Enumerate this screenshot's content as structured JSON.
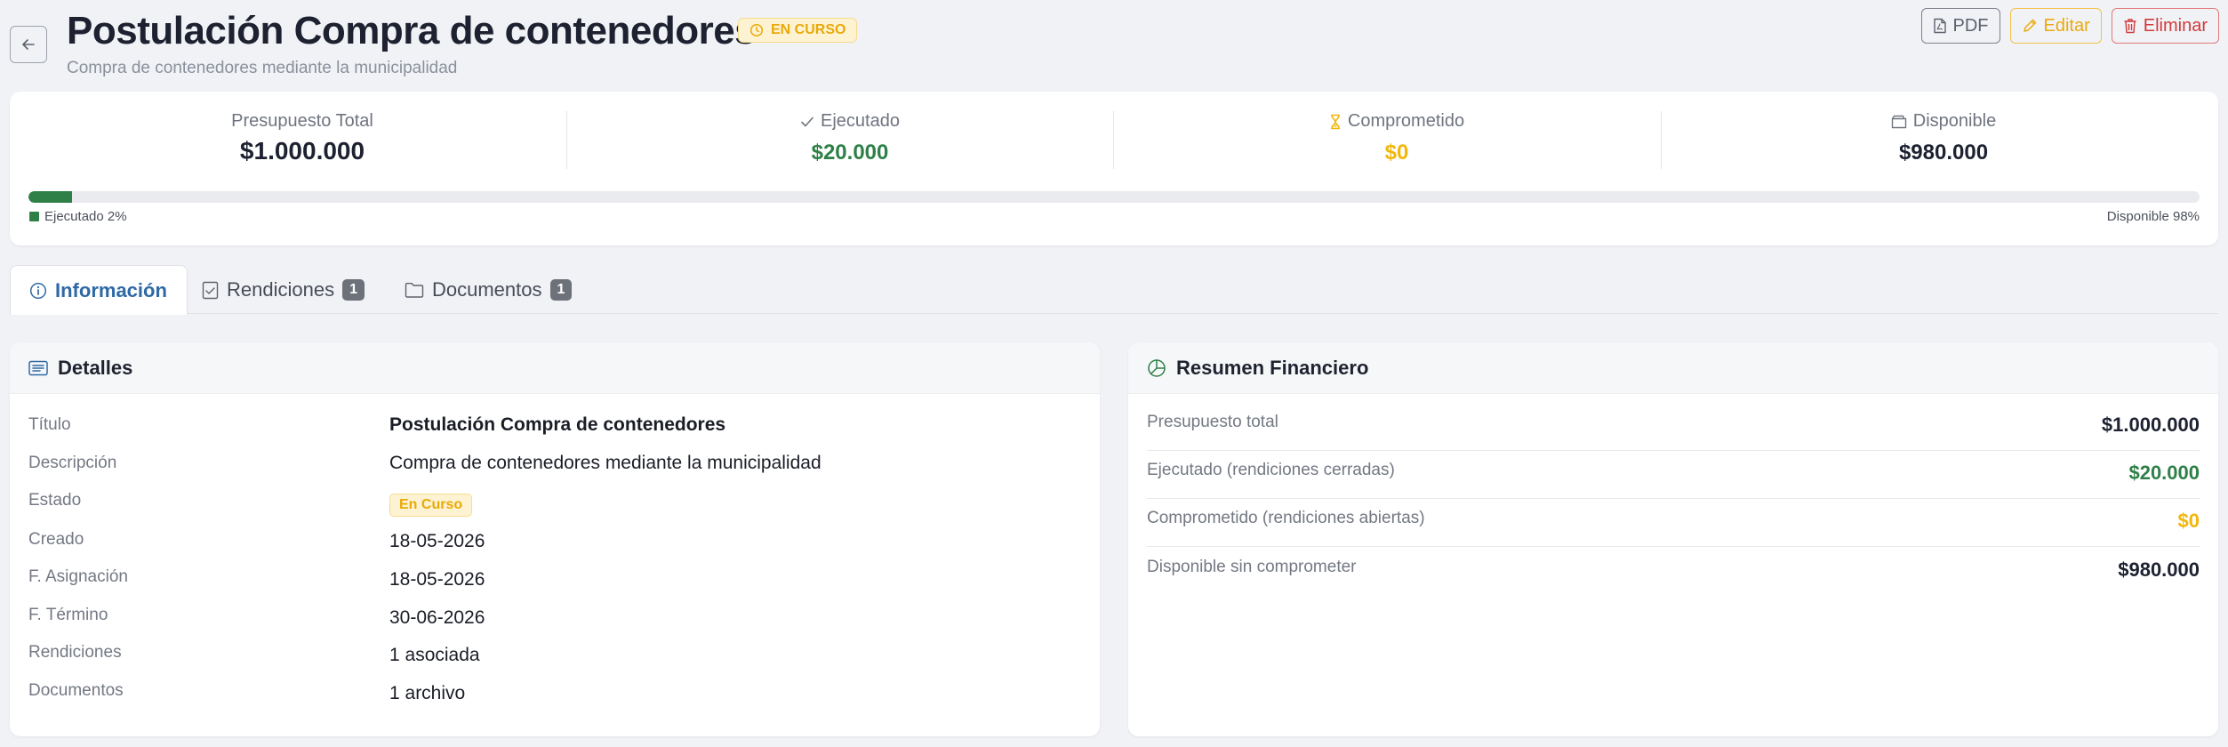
{
  "header": {
    "title": "Postulación Compra de contenedores",
    "status": "EN CURSO",
    "subtitle": "Compra de contenedores mediante la municipalidad",
    "actions": {
      "pdf": "PDF",
      "edit": "Editar",
      "delete": "Eliminar"
    }
  },
  "budget": {
    "total_label": "Presupuesto Total",
    "total_value": "$1.000.000",
    "executed_label": "Ejecutado",
    "executed_value": "$20.000",
    "committed_label": "Comprometido",
    "committed_value": "$0",
    "available_label": "Disponible",
    "available_value": "$980.000",
    "executed_percent": 2,
    "legend_executed": "Ejecutado 2%",
    "legend_available": "Disponible 98%"
  },
  "tabs": [
    {
      "label": "Información",
      "badge": ""
    },
    {
      "label": "Rendiciones",
      "badge": "1"
    },
    {
      "label": "Documentos",
      "badge": "1"
    }
  ],
  "details": {
    "heading": "Detalles",
    "rows": [
      {
        "label": "Título",
        "value": "Postulación Compra de contenedores"
      },
      {
        "label": "Descripción",
        "value": "Compra de contenedores mediante la municipalidad"
      },
      {
        "label": "Estado",
        "value": "En Curso"
      },
      {
        "label": "Creado",
        "value": "18-05-2026"
      },
      {
        "label": "F. Asignación",
        "value": "18-05-2026"
      },
      {
        "label": "F. Término",
        "value": "30-06-2026"
      },
      {
        "label": "Rendiciones",
        "value": "1 asociada"
      },
      {
        "label": "Documentos",
        "value": "1 archivo"
      }
    ]
  },
  "financial": {
    "heading": "Resumen Financiero",
    "rows": [
      {
        "label": "Presupuesto total",
        "value": "$1.000.000"
      },
      {
        "label": "Ejecutado (rendiciones cerradas)",
        "value": "$20.000"
      },
      {
        "label": "Comprometido (rendiciones abiertas)",
        "value": "$0"
      },
      {
        "label": "Disponible sin comprometer",
        "value": "$980.000"
      }
    ]
  },
  "colors": {
    "accent_blue": "#2f68a6",
    "executed_green": "#2e8048",
    "committed_amber": "#f2b70c",
    "danger_red": "#d23a3a"
  },
  "icons": {
    "back": "arrow-left-icon",
    "status": "clock-icon",
    "pdf": "file-pdf-icon",
    "edit": "pencil-icon",
    "delete": "trash-icon",
    "executed": "check-icon",
    "committed": "hourglass-icon",
    "available": "wallet-icon",
    "info_tab": "info-circle-icon",
    "rendiciones_tab": "checklist-icon",
    "documentos_tab": "folder-icon",
    "details": "list-card-icon",
    "financial": "pie-chart-icon"
  }
}
